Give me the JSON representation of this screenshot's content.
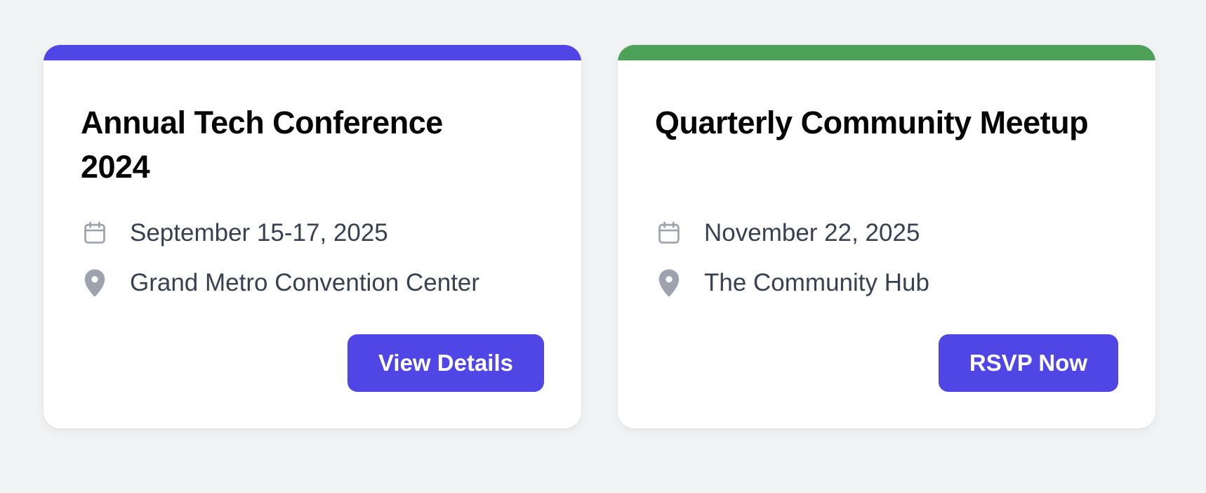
{
  "events": [
    {
      "accent_color": "#4f46e5",
      "title": "Annual Tech Conference 2024",
      "date_icon": "calendar-icon",
      "date": "September 15-17, 2025",
      "location_icon": "map-pin-icon",
      "location": "Grand Metro Convention Center",
      "button_label": "View Details",
      "button_color": "#4f46e5"
    },
    {
      "accent_color": "#4ea158",
      "title": "Quarterly Community Meetup",
      "date_icon": "calendar-icon",
      "date": "November 22, 2025",
      "location_icon": "map-pin-icon",
      "location": "The Community Hub",
      "button_label": "RSVP Now",
      "button_color": "#4f46e5"
    }
  ],
  "icon_color": "#9ca3af"
}
